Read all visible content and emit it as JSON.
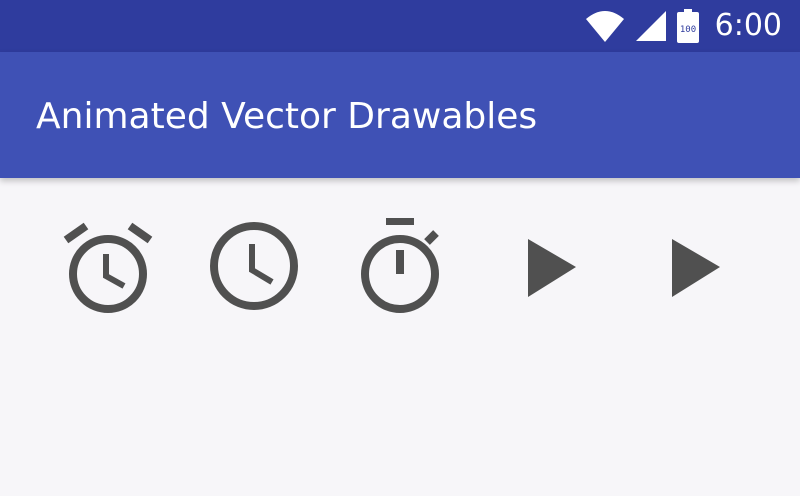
{
  "status_bar": {
    "time": "6:00",
    "battery_level": "100",
    "icons": [
      "wifi-icon",
      "cell-signal-icon",
      "battery-icon"
    ],
    "background_color": "#2f3c9e"
  },
  "app_bar": {
    "title": "Animated Vector Drawables",
    "background_color": "#3f51b5",
    "title_color": "#ffffff"
  },
  "content": {
    "background_color": "#f7f6f9",
    "icon_color": "#505050",
    "icons": [
      "alarm-clock-icon",
      "clock-icon",
      "stopwatch-icon",
      "play-icon",
      "play-icon"
    ]
  }
}
